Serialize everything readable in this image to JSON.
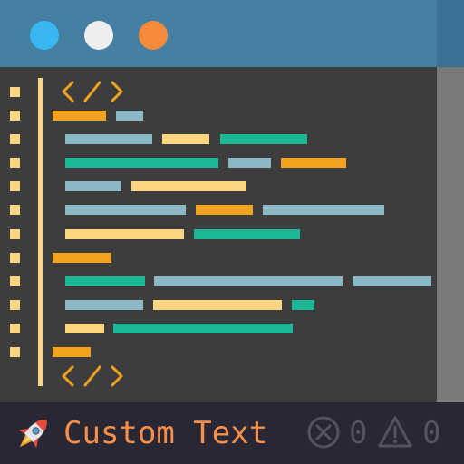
{
  "window": {
    "dots": [
      {
        "name": "window-dot-blue",
        "color": "#38b6f2"
      },
      {
        "name": "window-dot-white",
        "color": "#eeeeee"
      },
      {
        "name": "window-dot-orange",
        "color": "#f68c3a"
      }
    ]
  },
  "editor": {
    "open_tag_icon": "code-tag-icon",
    "close_tag_icon": "code-tag-icon",
    "accent": "#fbd580",
    "line_count": 12,
    "code_colors": {
      "orange": "#f3a21d",
      "blue": "#8ab9c5",
      "yellow": "#fbd580",
      "teal": "#1bb896"
    }
  },
  "statusbar": {
    "icon": "rocket-icon",
    "text": "Custom Text",
    "errors_icon": "error-circle-icon",
    "errors_count": "0",
    "warnings_icon": "warning-triangle-icon",
    "warnings_count": "0"
  }
}
